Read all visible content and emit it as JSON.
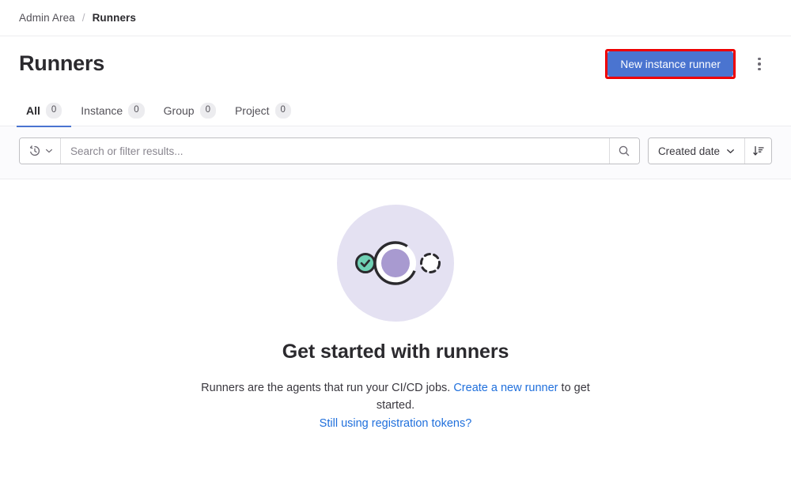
{
  "breadcrumb": {
    "parent": "Admin Area",
    "separator": "/",
    "current": "Runners"
  },
  "header": {
    "title": "Runners",
    "primary_button": "New instance runner",
    "primary_button_color": "#4a74d0",
    "highlight_color": "#ee0000",
    "more_actions_icon": "ellipsis-vertical-icon"
  },
  "tabs": [
    {
      "label": "All",
      "count": "0",
      "active": true
    },
    {
      "label": "Instance",
      "count": "0",
      "active": false
    },
    {
      "label": "Group",
      "count": "0",
      "active": false
    },
    {
      "label": "Project",
      "count": "0",
      "active": false
    }
  ],
  "filters": {
    "history_icon": "history-icon",
    "history_chevron_icon": "chevron-down-icon",
    "search_placeholder": "Search or filter results...",
    "search_value": "",
    "search_icon": "search-icon",
    "sort_label": "Created date",
    "sort_chevron_icon": "chevron-down-icon",
    "sort_direction_icon": "sort-descending-icon"
  },
  "empty_state": {
    "illustration_name": "runners-empty-illustration",
    "illustration_bg": "#e4e1f2",
    "accent_purple": "#a89ad0",
    "accent_green": "#6fd0b4",
    "title": "Get started with runners",
    "description_before": "Runners are the agents that run your CI/CD jobs.",
    "description_link": "Create a new runner",
    "description_after": "to get started.",
    "secondary_link": "Still using registration tokens?"
  }
}
